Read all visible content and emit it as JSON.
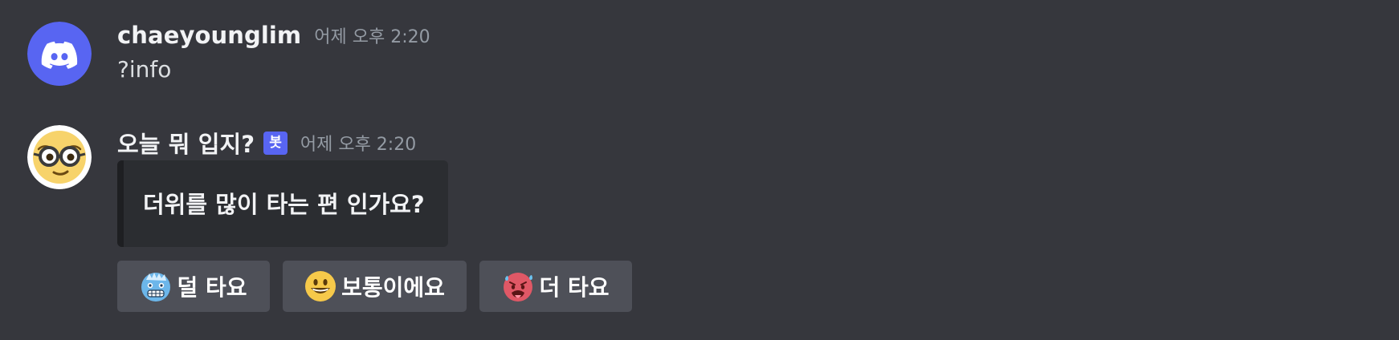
{
  "messages": [
    {
      "author": "chaeyounglim",
      "timestamp": "어제 오후 2:20",
      "content": "?info",
      "avatar_icon": "discord-logo-icon",
      "avatar_color": "#5865f2"
    },
    {
      "author": "오늘 뭐 입지?",
      "badge": "봇",
      "timestamp": "어제 오후 2:20",
      "avatar_icon": "nerd-face-icon",
      "embed": {
        "title": "더위를 많이 타는 편 인가요?"
      },
      "buttons": [
        {
          "emoji": "cold-face-icon",
          "label": "덜 타요"
        },
        {
          "emoji": "grinning-face-icon",
          "label": "보통이에요"
        },
        {
          "emoji": "hot-face-icon",
          "label": "더 타요"
        }
      ]
    }
  ],
  "colors": {
    "background": "#36373d",
    "embed_background": "#2b2d31",
    "button_background": "#4e5058",
    "bot_badge": "#5865f2",
    "timestamp": "#949ba4"
  }
}
